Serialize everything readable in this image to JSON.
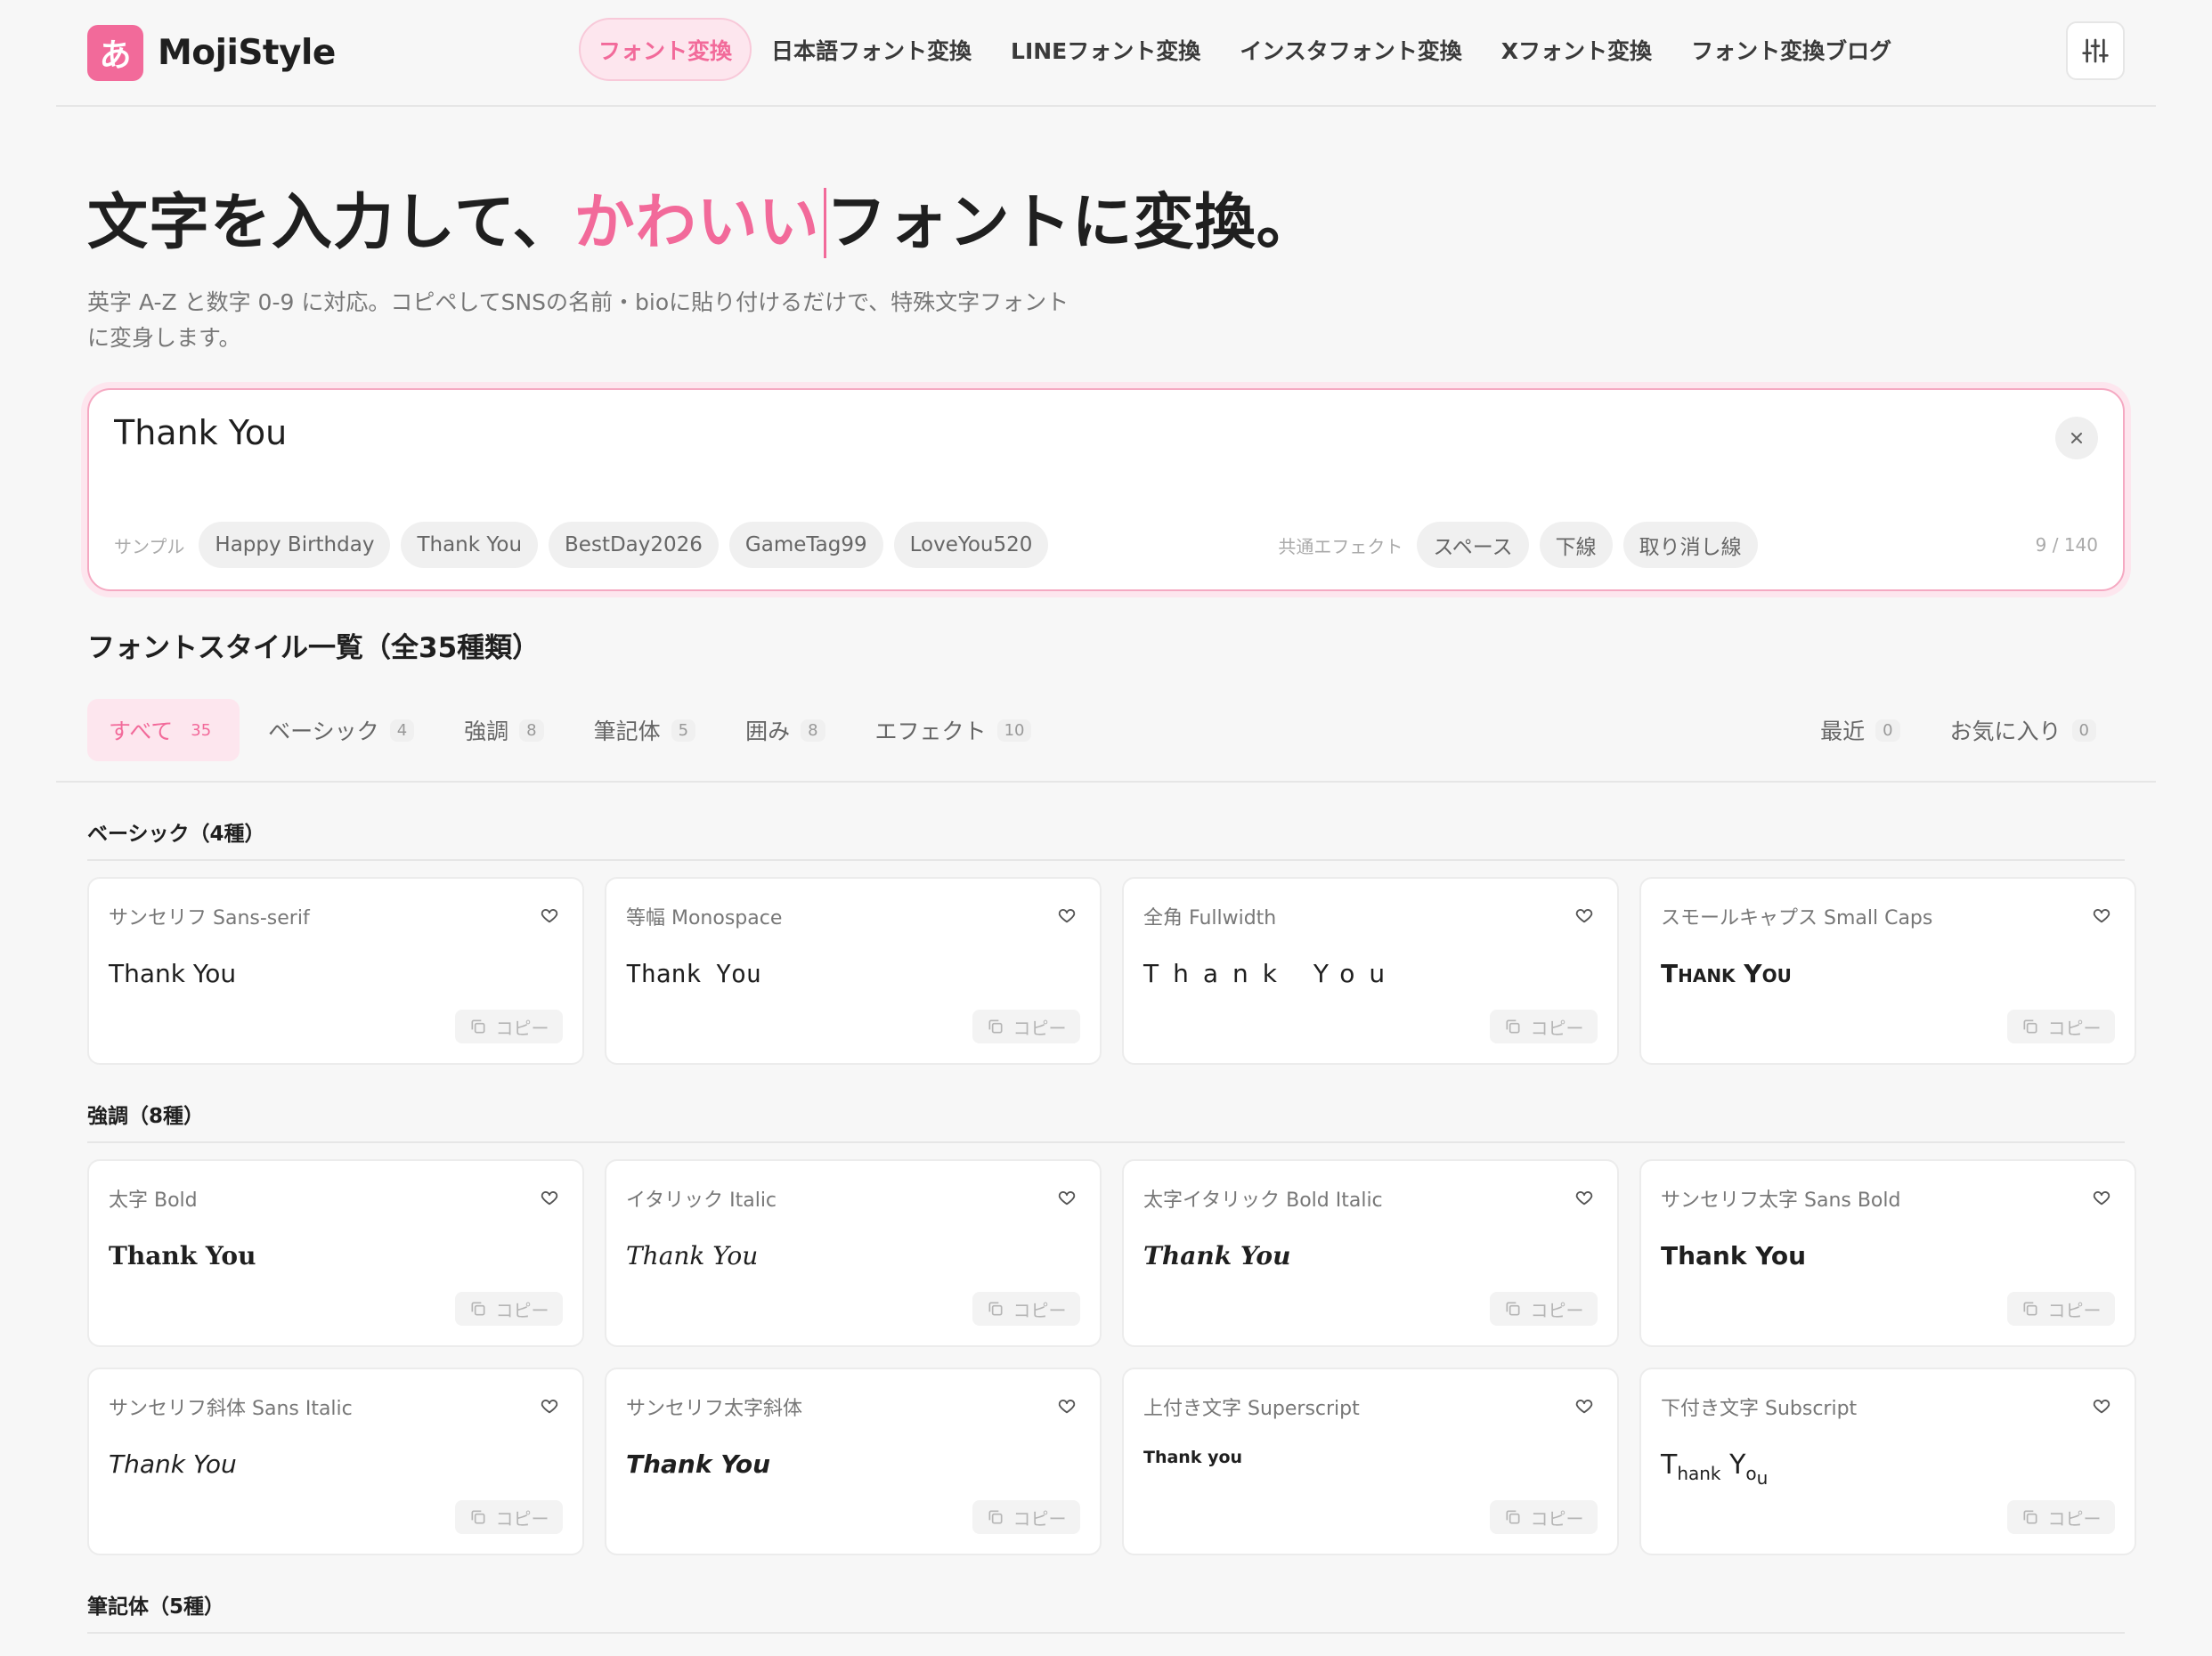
{
  "brand": {
    "mark": "あ",
    "name": "MojiStyle",
    "accent": "#f26a9a"
  },
  "nav": [
    {
      "label": "フォント変換",
      "active": true
    },
    {
      "label": "日本語フォント変換"
    },
    {
      "label": "LINEフォント変換"
    },
    {
      "label": "インスタフォント変換"
    },
    {
      "label": "Xフォント変換"
    },
    {
      "label": "フォント変換ブログ"
    }
  ],
  "settings_icon": "sliders-icon",
  "hero": {
    "title_pre": "文字を入力して、",
    "title_accent": "かわいい",
    "title_post": "フォントに変換。",
    "description": "英字 A-Z と数字 0-9 に対応。コピペしてSNSの名前・bioに貼り付けるだけで、特殊文字フォントに変身します。"
  },
  "input": {
    "value": "Thank You",
    "sample_label": "サンプル",
    "samples": [
      "Happy Birthday",
      "Thank You",
      "BestDay2026",
      "GameTag99",
      "LoveYou520"
    ],
    "effects_label": "共通エフェクト",
    "effects": [
      "スペース",
      "下線",
      "取り消し線"
    ],
    "counter": "9 / 140"
  },
  "list_title": "フォントスタイル一覧（全35種類）",
  "tabs": [
    {
      "label": "すべて",
      "count": "35",
      "active": true
    },
    {
      "label": "ベーシック",
      "count": "4"
    },
    {
      "label": "強調",
      "count": "8"
    },
    {
      "label": "筆記体",
      "count": "5"
    },
    {
      "label": "囲み",
      "count": "8"
    },
    {
      "label": "エフェクト",
      "count": "10"
    }
  ],
  "tabs_right": [
    {
      "label": "最近",
      "count": "0"
    },
    {
      "label": "お気に入り",
      "count": "0"
    }
  ],
  "copy_label": "コピー",
  "groups": [
    {
      "title": "ベーシック（4種）",
      "cards": [
        {
          "label": "サンセリフ Sans-serif",
          "sample": "Thank You",
          "style": "s-sans"
        },
        {
          "label": "等幅 Monospace",
          "sample": "Thank You",
          "style": "s-mono"
        },
        {
          "label": "全角 Fullwidth",
          "sample": "Thank You",
          "style": "s-wide"
        },
        {
          "label": "スモールキャプス Small Caps",
          "sample": "Thank You",
          "style": "s-caps"
        }
      ]
    },
    {
      "title": "強調（8種）",
      "cards": [
        {
          "label": "太字 Bold",
          "sample": "Thank You",
          "style": "s-bold"
        },
        {
          "label": "イタリック Italic",
          "sample": "Thank You",
          "style": "s-italic"
        },
        {
          "label": "太字イタリック Bold Italic",
          "sample": "Thank You",
          "style": "s-bolditalic"
        },
        {
          "label": "サンセリフ太字 Sans Bold",
          "sample": "Thank You",
          "style": "s-sansbold"
        },
        {
          "label": "サンセリフ斜体 Sans Italic",
          "sample": "Thank You",
          "style": "s-sansitalic"
        },
        {
          "label": "サンセリフ太字斜体",
          "sample": "Thank You",
          "style": "s-sansbolditalic"
        },
        {
          "label": "上付き文字 Superscript",
          "sample": "Thank you",
          "style": "s-super"
        },
        {
          "label": "下付き文字 Subscript",
          "sample": "Thank You",
          "style": "s-sub"
        }
      ]
    },
    {
      "title": "筆記体（5種）",
      "cards": []
    }
  ]
}
